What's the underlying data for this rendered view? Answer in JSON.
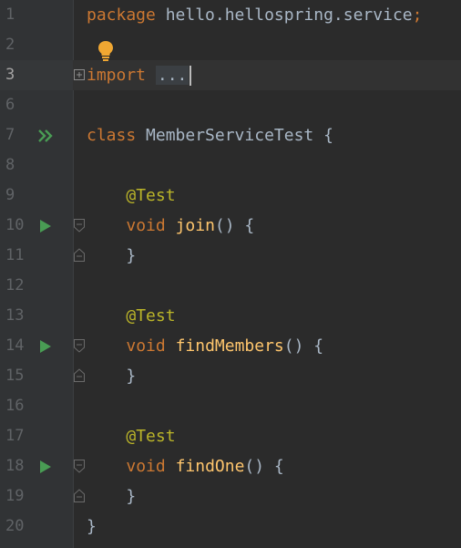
{
  "editor": {
    "lines": [
      {
        "num": "1",
        "tokens": [
          {
            "cls": "kw",
            "text": "package"
          },
          {
            "cls": "plain",
            "text": " hello.hellospring.service"
          },
          {
            "cls": "kw",
            "text": ";"
          }
        ]
      },
      {
        "num": "2",
        "tokens": []
      },
      {
        "num": "3",
        "tokens": [
          {
            "cls": "kw",
            "text": "import"
          },
          {
            "cls": "plain",
            "text": " "
          },
          {
            "cls": "fold-box",
            "text": "..."
          }
        ]
      },
      {
        "num": "6",
        "tokens": []
      },
      {
        "num": "7",
        "tokens": [
          {
            "cls": "kw",
            "text": "class"
          },
          {
            "cls": "plain",
            "text": " MemberServiceTest {"
          }
        ]
      },
      {
        "num": "8",
        "tokens": []
      },
      {
        "num": "9",
        "tokens": [
          {
            "cls": "plain",
            "text": "    "
          },
          {
            "cls": "ann",
            "text": "@Test"
          }
        ]
      },
      {
        "num": "10",
        "tokens": [
          {
            "cls": "plain",
            "text": "    "
          },
          {
            "cls": "kw",
            "text": "void"
          },
          {
            "cls": "plain",
            "text": " "
          },
          {
            "cls": "fn",
            "text": "join"
          },
          {
            "cls": "plain",
            "text": "() {"
          }
        ]
      },
      {
        "num": "11",
        "tokens": [
          {
            "cls": "plain",
            "text": "    }"
          }
        ]
      },
      {
        "num": "12",
        "tokens": []
      },
      {
        "num": "13",
        "tokens": [
          {
            "cls": "plain",
            "text": "    "
          },
          {
            "cls": "ann",
            "text": "@Test"
          }
        ]
      },
      {
        "num": "14",
        "tokens": [
          {
            "cls": "plain",
            "text": "    "
          },
          {
            "cls": "kw",
            "text": "void"
          },
          {
            "cls": "plain",
            "text": " "
          },
          {
            "cls": "fn",
            "text": "findMembers"
          },
          {
            "cls": "plain",
            "text": "() {"
          }
        ]
      },
      {
        "num": "15",
        "tokens": [
          {
            "cls": "plain",
            "text": "    }"
          }
        ]
      },
      {
        "num": "16",
        "tokens": []
      },
      {
        "num": "17",
        "tokens": [
          {
            "cls": "plain",
            "text": "    "
          },
          {
            "cls": "ann",
            "text": "@Test"
          }
        ]
      },
      {
        "num": "18",
        "tokens": [
          {
            "cls": "plain",
            "text": "    "
          },
          {
            "cls": "kw",
            "text": "void"
          },
          {
            "cls": "plain",
            "text": " "
          },
          {
            "cls": "fn",
            "text": "findOne"
          },
          {
            "cls": "plain",
            "text": "() {"
          }
        ]
      },
      {
        "num": "19",
        "tokens": [
          {
            "cls": "plain",
            "text": "    }"
          }
        ]
      },
      {
        "num": "20",
        "tokens": [
          {
            "cls": "plain",
            "text": "}"
          }
        ]
      }
    ],
    "current_line": "3",
    "run_class_lines": [
      "7"
    ],
    "run_method_lines": [
      "10",
      "14",
      "18"
    ],
    "fold_start_lines": [
      "3",
      "10",
      "14",
      "18"
    ],
    "fold_end_lines": [
      "11",
      "15",
      "19"
    ],
    "intention_bulb_line": "2"
  },
  "colors": {
    "background": "#2b2b2b",
    "gutter": "#313335",
    "keyword": "#cc7832",
    "annotation": "#bbb529",
    "function": "#ffc66d",
    "text": "#a9b7c6",
    "line_number": "#606366",
    "run_icon": "#499c54",
    "bulb": "#f0a732"
  },
  "icons": {
    "run_class": "double-play-icon",
    "run_method": "play-icon",
    "fold_start": "fold-collapse-icon",
    "fold_end": "fold-end-icon",
    "fold_expand": "fold-expand-icon",
    "intention": "lightbulb-icon"
  }
}
